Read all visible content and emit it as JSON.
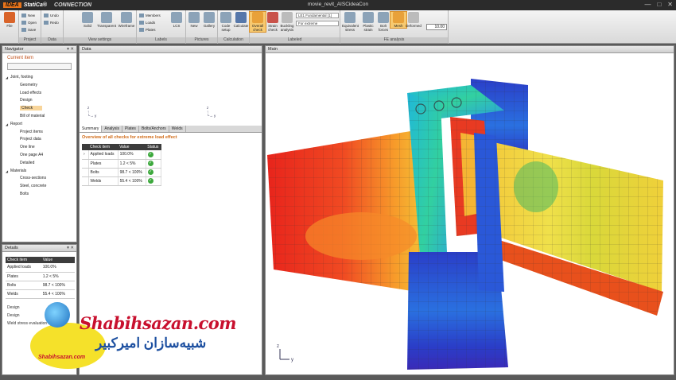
{
  "window": {
    "brand": "IDEA",
    "product": "StatiCa®",
    "module": "CONNECTION",
    "title": "movie_revit_AISCideaCon",
    "buttons": [
      "—",
      "□",
      "✕"
    ]
  },
  "ribbon": {
    "file": "File",
    "project": {
      "label": "Project",
      "new": "New",
      "open": "Open",
      "save": "Save"
    },
    "data": {
      "label": "Data",
      "undo": "Undo",
      "redo": "Redo"
    },
    "view_settings": {
      "label": "View settings",
      "solid": "Solid",
      "transparent": "Transparent",
      "wireframe": "Wireframe"
    },
    "labels": {
      "label": "Labels",
      "members": "Members",
      "loads": "Loads",
      "plates": "Plates",
      "lcs": "LCS"
    },
    "pictures": {
      "label": "Pictures",
      "new": "New",
      "gallery": "Gallery"
    },
    "calculation": {
      "label": "Calculation",
      "code_setup": "Code setup",
      "calculate": "Calculate"
    },
    "labeled": {
      "label": "Labeled",
      "overall_check": "Overall check",
      "strain_check": "Strain check",
      "buckling_analysis": "Buckling analysis",
      "combo1": "LE1 Fundamental (1)",
      "combo2": "For extreme"
    },
    "fe_analysis": {
      "label": "FE analysis",
      "equivalent_stress": "Equivalent stress",
      "plastic_strain": "Plastic strain",
      "bolt_forces": "Bolt forces",
      "mesh": "Mesh",
      "deformed": "Deformed"
    },
    "zoom": "10.00"
  },
  "navigator": {
    "title": "Navigator",
    "current_item": "Current item",
    "tree": [
      {
        "label": "Joint, footing",
        "level": 0
      },
      {
        "label": "Geometry",
        "level": 1
      },
      {
        "label": "Load effects",
        "level": 1
      },
      {
        "label": "Design",
        "level": 1
      },
      {
        "label": "Check",
        "level": 1,
        "selected": true
      },
      {
        "label": "Bill of material",
        "level": 1
      },
      {
        "label": "Report",
        "level": 0
      },
      {
        "label": "Project items",
        "level": 1
      },
      {
        "label": "Project data",
        "level": 1
      },
      {
        "label": "One line",
        "level": 1
      },
      {
        "label": "One page A4",
        "level": 1
      },
      {
        "label": "Detailed",
        "level": 1
      },
      {
        "label": "Materials",
        "level": 0
      },
      {
        "label": "Cross-sections",
        "level": 1
      },
      {
        "label": "Steel, concrete",
        "level": 1
      },
      {
        "label": "Bolts",
        "level": 1
      }
    ]
  },
  "details": {
    "title": "Details",
    "headers": [
      "Check item",
      "Value"
    ],
    "rows": [
      [
        "Applied loads",
        "100.0%"
      ],
      [
        "Plates",
        "1.2 < 5%"
      ],
      [
        "Bolts",
        "98.7 < 100%"
      ],
      [
        "Welds",
        "55.4 < 100%"
      ]
    ],
    "extra": [
      "Design",
      "Design",
      "Weld stress evaluation",
      "average"
    ]
  },
  "data_panel": {
    "title": "Data",
    "tabs": [
      "Summary",
      "Analysis",
      "Plates",
      "Bolts/Anchors",
      "Welds"
    ],
    "overview": "Overview of all checks for extreme load effect",
    "headers": [
      "Check item",
      "Value",
      "Status"
    ],
    "rows": [
      [
        "Applied loads",
        "100.0%"
      ],
      [
        "Plates",
        "1.2 < 5%"
      ],
      [
        "Bolts",
        "98.7 < 100%"
      ],
      [
        "Welds",
        "55.4 < 100%"
      ]
    ]
  },
  "main_panel": {
    "title": "Main",
    "axis_z": "z",
    "axis_y": "y"
  },
  "watermark": {
    "latin": "Shabihsazan.com",
    "persian": "شبیه‌سازان امیرکبیر",
    "small": "Shabihsazan.com"
  }
}
